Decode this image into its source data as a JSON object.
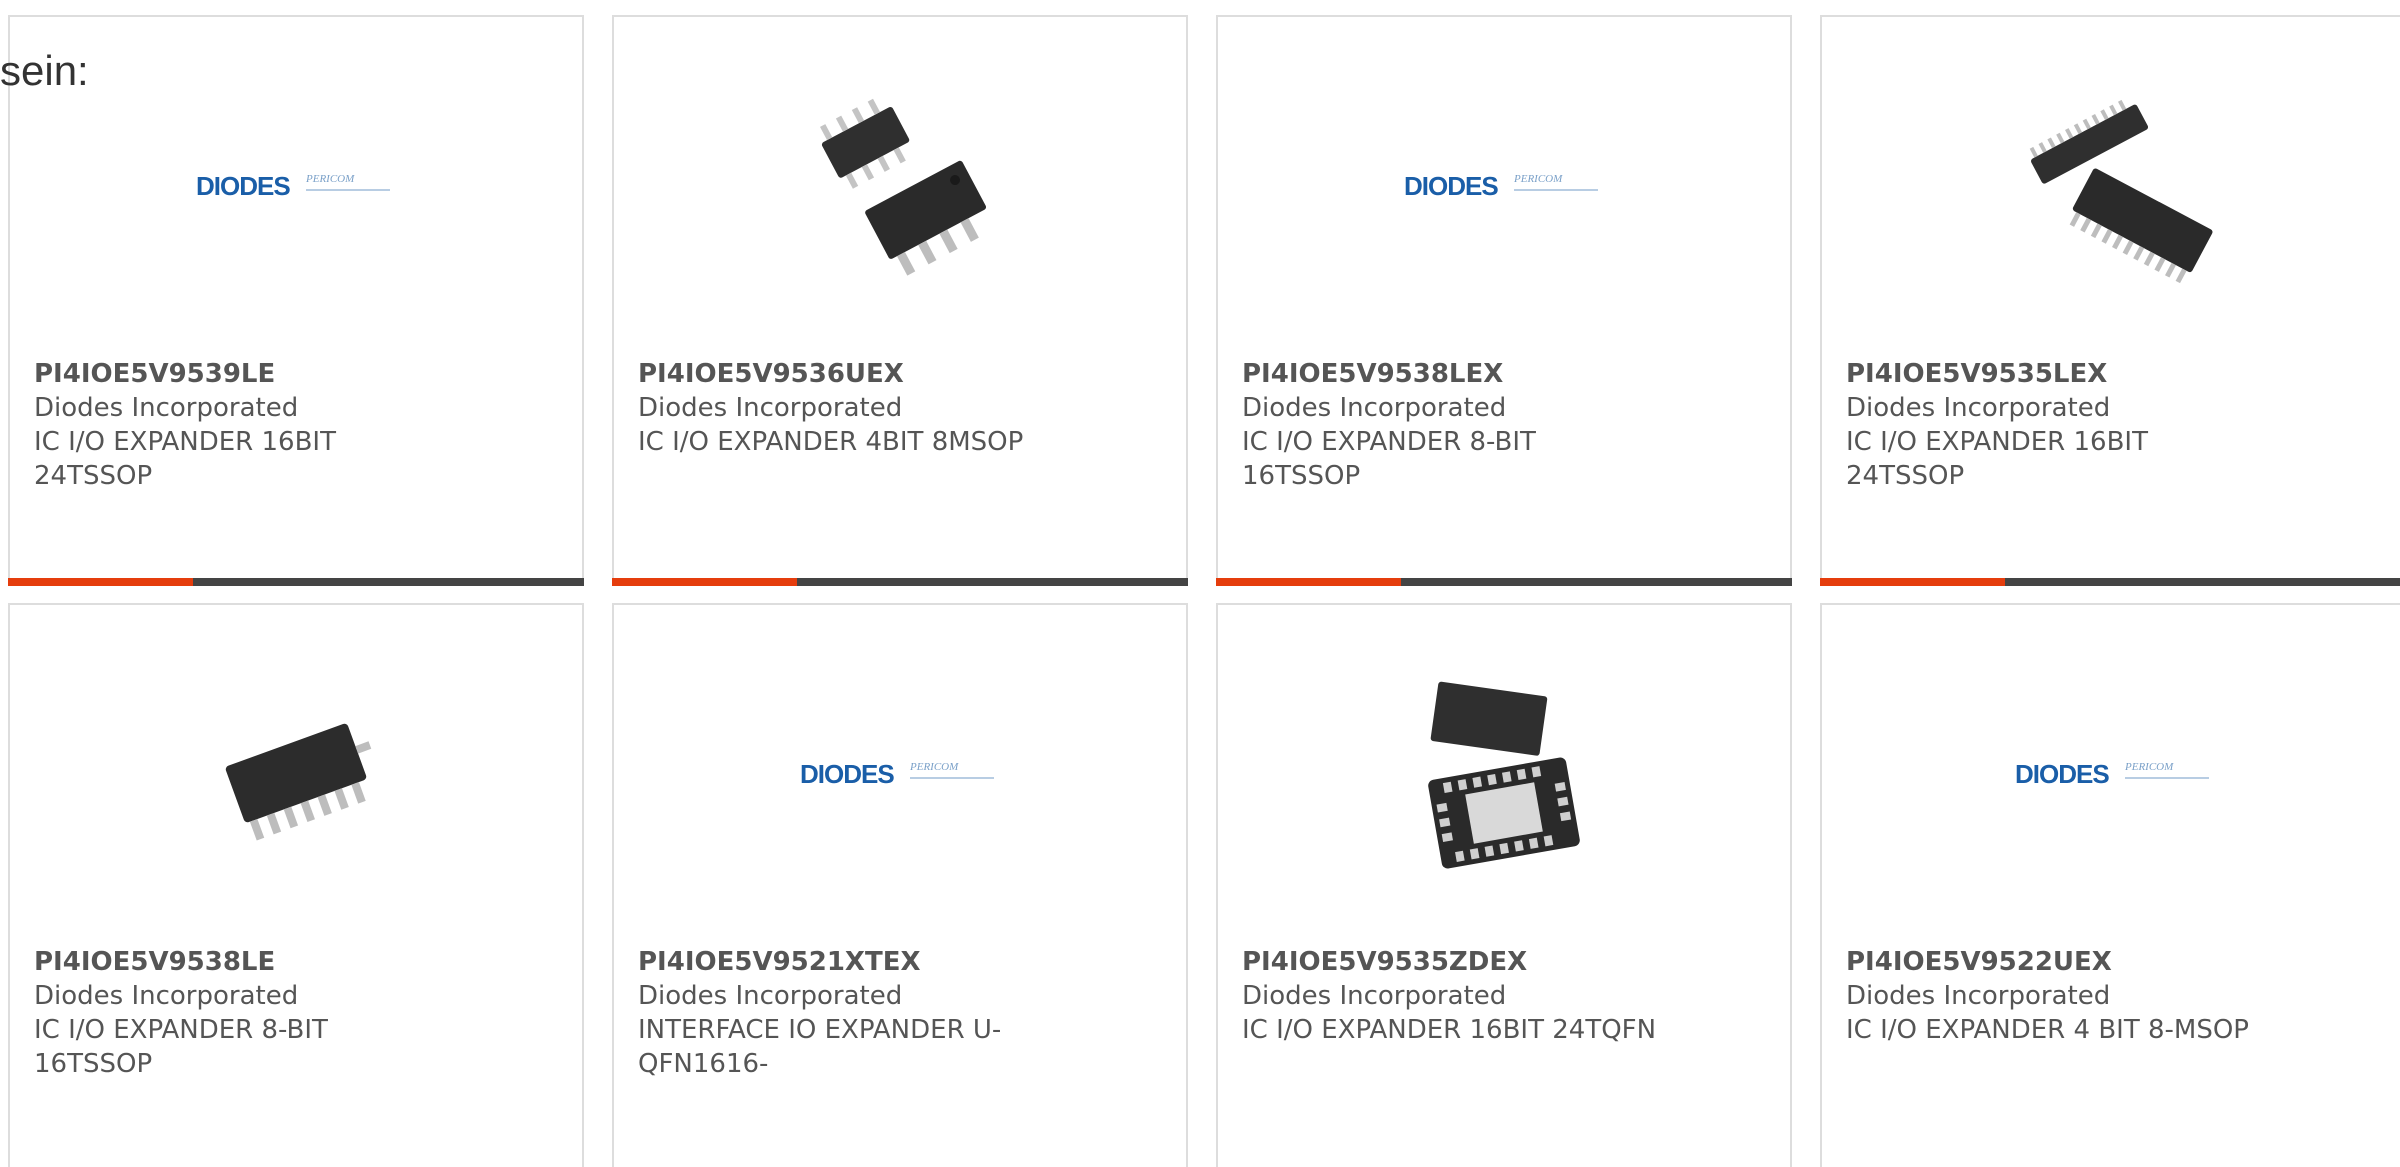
{
  "heading": "sein:",
  "colors": {
    "accent": "#e53d0d",
    "bar": "#444444",
    "text": "#555555",
    "logo": "#1a5ea8"
  },
  "products": [
    {
      "part_number": "PI4IOE5V9539LE",
      "manufacturer": "Diodes Incorporated",
      "description": "IC I/O EXPANDER 16BIT 24TSSOP",
      "image": "diodes-pericom-logo",
      "logo_text": "DIODES",
      "logo_sub": "PERICOM"
    },
    {
      "part_number": "PI4IOE5V9536UEX",
      "manufacturer": "Diodes Incorporated",
      "description": "IC I/O EXPANDER 4BIT 8MSOP",
      "image": "msop-chip"
    },
    {
      "part_number": "PI4IOE5V9538LEX",
      "manufacturer": "Diodes Incorporated",
      "description": "IC I/O EXPANDER 8-BIT 16TSSOP",
      "image": "diodes-pericom-logo",
      "logo_text": "DIODES",
      "logo_sub": "PERICOM"
    },
    {
      "part_number": "PI4IOE5V9535LEX",
      "manufacturer": "Diodes Incorporated",
      "description": "IC I/O EXPANDER 16BIT 24TSSOP",
      "image": "tssop-chip"
    },
    {
      "part_number": "PI4IOE5V9538LE",
      "manufacturer": "Diodes Incorporated",
      "description": "IC I/O EXPANDER 8-BIT 16TSSOP",
      "image": "tssop-chip"
    },
    {
      "part_number": "PI4IOE5V9521XTEX",
      "manufacturer": "Diodes Incorporated",
      "description": "INTERFACE IO EXPANDER U-QFN1616-",
      "image": "diodes-pericom-logo",
      "logo_text": "DIODES",
      "logo_sub": "PERICOM"
    },
    {
      "part_number": "PI4IOE5V9535ZDEX",
      "manufacturer": "Diodes Incorporated",
      "description": "IC I/O EXPANDER 16BIT 24TQFN",
      "image": "tqfn-chip"
    },
    {
      "part_number": "PI4IOE5V9522UEX",
      "manufacturer": "Diodes Incorporated",
      "description": "IC I/O EXPANDER 4 BIT 8-MSOP",
      "image": "diodes-pericom-logo",
      "logo_text": "DIODES",
      "logo_sub": "PERICOM"
    }
  ]
}
